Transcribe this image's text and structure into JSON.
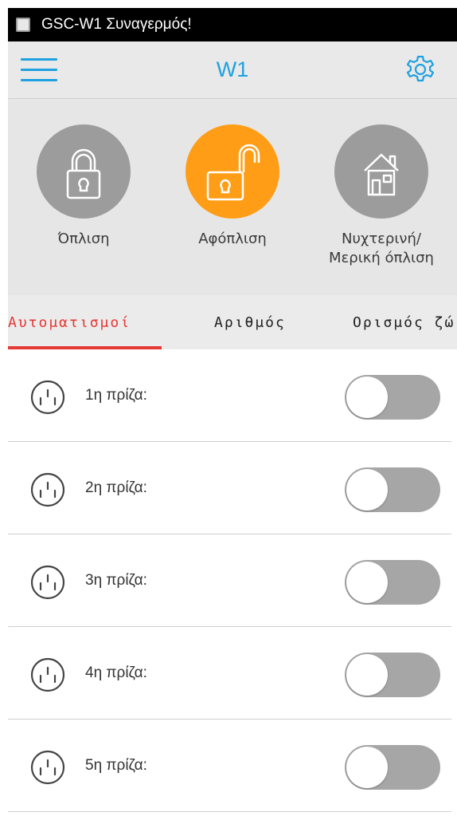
{
  "status_bar": {
    "title": "GSC-W1 Συναγερμός!"
  },
  "action_bar": {
    "title": "W1",
    "menu_icon": "hamburger-icon",
    "settings_icon": "gear-icon",
    "accent_color": "#1ea1e0"
  },
  "modes": [
    {
      "label": "Όπλιση",
      "icon": "lock-closed-icon",
      "active": false
    },
    {
      "label": "Αφόπλιση",
      "icon": "lock-open-icon",
      "active": true
    },
    {
      "label_line1": "Νυχτερινή/",
      "label_line2": "Μερική όπλιση",
      "icon": "house-icon",
      "active": false
    }
  ],
  "mode_colors": {
    "active": "#ff9d16",
    "inactive": "#9c9c9c"
  },
  "tabs": [
    {
      "label": "Αυτοματισμοί",
      "active": true
    },
    {
      "label": "Αριθμός",
      "active": false
    },
    {
      "label": "Ορισμός ζώ",
      "active": false
    }
  ],
  "sockets": [
    {
      "label": "1η πρίζα:",
      "on": false
    },
    {
      "label": "2η πρίζα:",
      "on": false
    },
    {
      "label": "3η πρίζα:",
      "on": false
    },
    {
      "label": "4η πρίζα:",
      "on": false
    },
    {
      "label": "5η πρίζα:",
      "on": false
    }
  ]
}
